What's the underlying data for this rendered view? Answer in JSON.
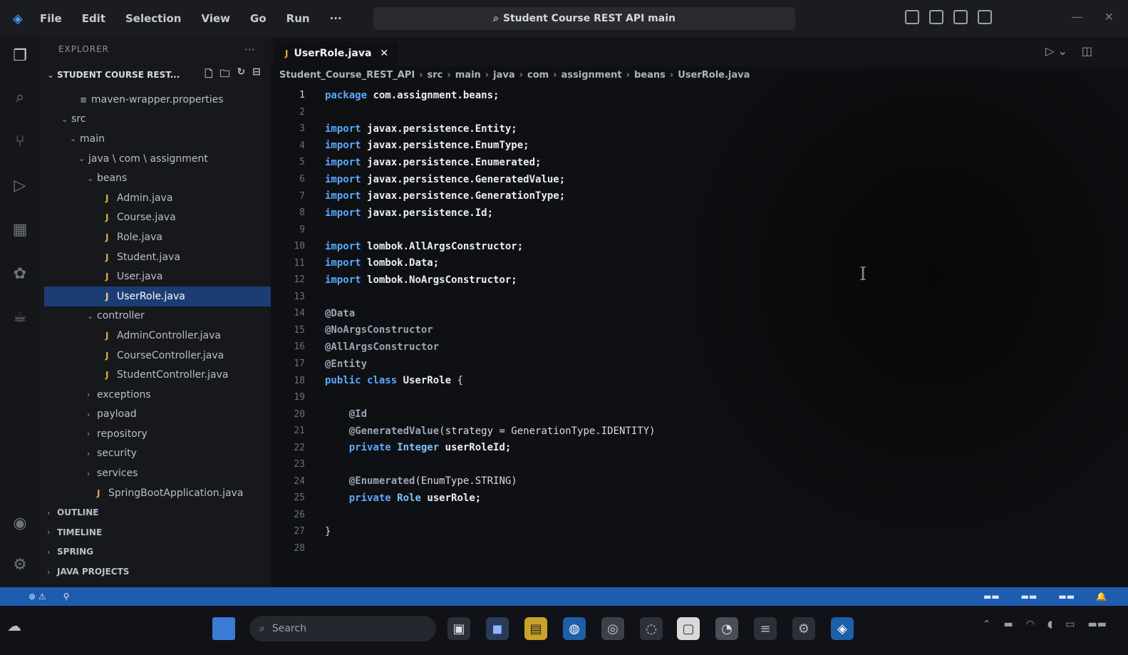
{
  "titlebar": {
    "menu": [
      "File",
      "Edit",
      "Selection",
      "View",
      "Go",
      "Run",
      "···"
    ],
    "search_text": "Student Course REST API main"
  },
  "sidebar": {
    "header": "EXPLORER",
    "project": "STUDENT COURSE REST...",
    "tree": [
      {
        "label": "maven-wrapper.properties",
        "level": 1,
        "kind": "file",
        "chev": ""
      },
      {
        "label": "src",
        "level": 0,
        "kind": "folder",
        "chev": "v"
      },
      {
        "label": "main",
        "level": 1,
        "kind": "folder",
        "chev": "v"
      },
      {
        "label": "java \\ com \\ assignment",
        "level": 2,
        "kind": "folder",
        "chev": "v"
      },
      {
        "label": "beans",
        "level": 3,
        "kind": "folder",
        "chev": "v"
      },
      {
        "label": "Admin.java",
        "level": 4,
        "kind": "java",
        "chev": ""
      },
      {
        "label": "Course.java",
        "level": 4,
        "kind": "java",
        "chev": ""
      },
      {
        "label": "Role.java",
        "level": 4,
        "kind": "java",
        "chev": ""
      },
      {
        "label": "Student.java",
        "level": 4,
        "kind": "java",
        "chev": ""
      },
      {
        "label": "User.java",
        "level": 4,
        "kind": "java",
        "chev": ""
      },
      {
        "label": "UserRole.java",
        "level": 4,
        "kind": "java",
        "chev": "",
        "selected": true
      },
      {
        "label": "controller",
        "level": 3,
        "kind": "folder",
        "chev": "v"
      },
      {
        "label": "AdminController.java",
        "level": 4,
        "kind": "java",
        "chev": ""
      },
      {
        "label": "CourseController.java",
        "level": 4,
        "kind": "java",
        "chev": ""
      },
      {
        "label": "StudentController.java",
        "level": 4,
        "kind": "java",
        "chev": ""
      },
      {
        "label": "exceptions",
        "level": 3,
        "kind": "folder",
        "chev": ">"
      },
      {
        "label": "payload",
        "level": 3,
        "kind": "folder",
        "chev": ">"
      },
      {
        "label": "repository",
        "level": 3,
        "kind": "folder",
        "chev": ">"
      },
      {
        "label": "security",
        "level": 3,
        "kind": "folder",
        "chev": ">"
      },
      {
        "label": "services",
        "level": 3,
        "kind": "folder",
        "chev": ">"
      },
      {
        "label": "SpringBootApplication.java",
        "level": 3,
        "kind": "java",
        "chev": ""
      },
      {
        "label": "OUTLINE",
        "level": 0,
        "kind": "section",
        "chev": ">"
      },
      {
        "label": "TIMELINE",
        "level": 0,
        "kind": "section",
        "chev": ">"
      },
      {
        "label": "SPRING",
        "level": 0,
        "kind": "section",
        "chev": ">"
      },
      {
        "label": "JAVA PROJECTS",
        "level": 0,
        "kind": "section",
        "chev": ">"
      }
    ]
  },
  "editor": {
    "tab_label": "UserRole.java",
    "breadcrumb": [
      "Student_Course_REST_API",
      "src",
      "main",
      "java",
      "com",
      "assignment",
      "beans",
      "UserRole.java"
    ],
    "lines": [
      [
        [
          "kw",
          "package "
        ],
        [
          "id",
          "com.assignment.beans;"
        ]
      ],
      [],
      [
        [
          "kw",
          "import "
        ],
        [
          "id",
          "javax.persistence.Entity;"
        ]
      ],
      [
        [
          "kw",
          "import "
        ],
        [
          "id",
          "javax.persistence.EnumType;"
        ]
      ],
      [
        [
          "kw",
          "import "
        ],
        [
          "id",
          "javax.persistence.Enumerated;"
        ]
      ],
      [
        [
          "kw",
          "import "
        ],
        [
          "id",
          "javax.persistence.GeneratedValue;"
        ]
      ],
      [
        [
          "kw",
          "import "
        ],
        [
          "id",
          "javax.persistence.GenerationType;"
        ]
      ],
      [
        [
          "kw",
          "import "
        ],
        [
          "id",
          "javax.persistence.Id;"
        ]
      ],
      [],
      [
        [
          "kw",
          "import "
        ],
        [
          "id",
          "lombok.AllArgsConstructor;"
        ]
      ],
      [
        [
          "kw",
          "import "
        ],
        [
          "id",
          "lombok.Data;"
        ]
      ],
      [
        [
          "kw",
          "import "
        ],
        [
          "id",
          "lombok.NoArgsConstructor;"
        ]
      ],
      [],
      [
        [
          "an",
          "@Data"
        ]
      ],
      [
        [
          "an",
          "@NoArgsConstructor"
        ]
      ],
      [
        [
          "an",
          "@AllArgsConstructor"
        ]
      ],
      [
        [
          "an",
          "@Entity"
        ]
      ],
      [
        [
          "kw",
          "public class "
        ],
        [
          "id",
          "UserRole "
        ],
        [
          "pl",
          "{"
        ]
      ],
      [],
      [
        [
          "pl",
          "    "
        ],
        [
          "an",
          "@Id"
        ]
      ],
      [
        [
          "pl",
          "    "
        ],
        [
          "an",
          "@GeneratedValue"
        ],
        [
          "pl",
          "(strategy = GenerationType.IDENTITY)"
        ]
      ],
      [
        [
          "pl",
          "    "
        ],
        [
          "kw",
          "private "
        ],
        [
          "ty",
          "Integer "
        ],
        [
          "id",
          "userRoleId;"
        ]
      ],
      [],
      [
        [
          "pl",
          "    "
        ],
        [
          "an",
          "@Enumerated"
        ],
        [
          "pl",
          "(EnumType.STRING)"
        ]
      ],
      [
        [
          "pl",
          "    "
        ],
        [
          "kw",
          "private "
        ],
        [
          "ty",
          "Role "
        ],
        [
          "id",
          "userRole;"
        ]
      ],
      [],
      [
        [
          "pl",
          "}"
        ]
      ],
      []
    ]
  },
  "taskbar": {
    "search_placeholder": "Search"
  }
}
